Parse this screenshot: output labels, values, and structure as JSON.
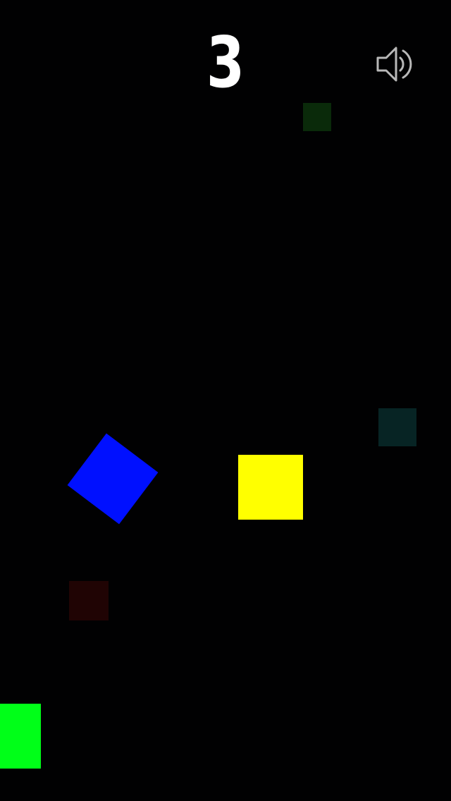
{
  "hud": {
    "score": "3",
    "sound_icon": "speaker-on-icon"
  },
  "colors": {
    "background": "#010102",
    "score_text": "#ffffff",
    "sound_icon": "#b8b8b8"
  },
  "tiles": [
    {
      "name": "faint-green-tile",
      "color": "#0a2a0a",
      "state": "faded"
    },
    {
      "name": "faint-teal-tile",
      "color": "#072424",
      "state": "faded"
    },
    {
      "name": "blue-tile",
      "color": "#0010ff",
      "state": "active"
    },
    {
      "name": "yellow-tile",
      "color": "#ffff00",
      "state": "active"
    },
    {
      "name": "faint-red-tile",
      "color": "#200404",
      "state": "faded"
    },
    {
      "name": "green-tile",
      "color": "#00ff18",
      "state": "active"
    }
  ]
}
